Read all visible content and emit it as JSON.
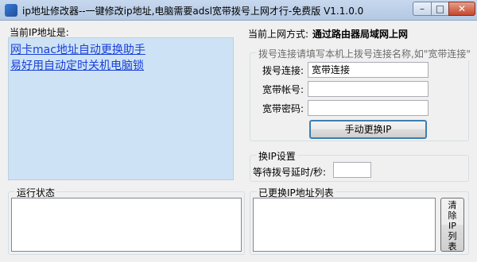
{
  "window": {
    "title": "ip地址修改器--一键修改ip地址,电脑需要adsl宽带拨号上网才行-免费版 V1.1.0.0",
    "min_glyph": "–",
    "max_glyph": "□",
    "close_glyph": "✕"
  },
  "left": {
    "current_ip_label": "当前IP地址是:",
    "links": [
      "网卡mac地址自动更换助手",
      "易好用自动定时关机电脑锁"
    ]
  },
  "net_mode": {
    "label": "当前上网方式:",
    "value": "通过路由器局域网上网"
  },
  "dial_group": {
    "legend": "拨号连接请填写本机上拨号连接名称,如\"宽带连接\"",
    "connection_label": "拨号连接:",
    "connection_value": "宽带连接",
    "account_label": "宽带帐号:",
    "account_value": "",
    "password_label": "宽带密码:",
    "password_value": "",
    "change_ip_button": "手动更换IP"
  },
  "switch_group": {
    "legend": "换IP设置",
    "delay_label": "等待拨号延时/秒:",
    "delay_value": ""
  },
  "status_group": {
    "legend": "运行状态"
  },
  "history_group": {
    "legend": "已更换IP地址列表",
    "clear_button": [
      "清",
      "除",
      "IP",
      "列",
      "表"
    ]
  }
}
